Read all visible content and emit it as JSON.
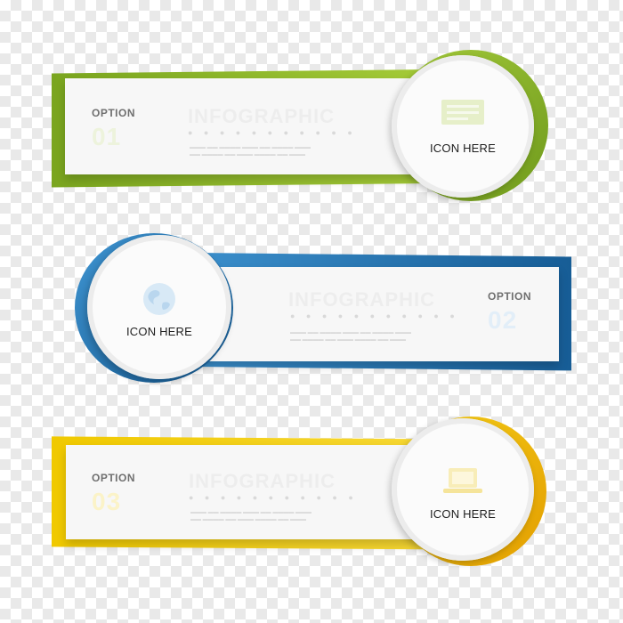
{
  "colors": {
    "green": "#8bb72a",
    "blue": "#1f6fad",
    "yellow": "#f2c100"
  },
  "banners": [
    {
      "option_label": "OPTION",
      "option_number": "01",
      "title": "INFOGRAPHIC",
      "icon_label": "ICON HERE",
      "icon": "presentation-icon",
      "accent": "green"
    },
    {
      "option_label": "OPTION",
      "option_number": "02",
      "title": "INFOGRAPHIC",
      "icon_label": "ICON HERE",
      "icon": "globe-icon",
      "accent": "blue"
    },
    {
      "option_label": "OPTION",
      "option_number": "03",
      "title": "INFOGRAPHIC",
      "icon_label": "ICON HERE",
      "icon": "laptop-icon",
      "accent": "yellow"
    }
  ]
}
